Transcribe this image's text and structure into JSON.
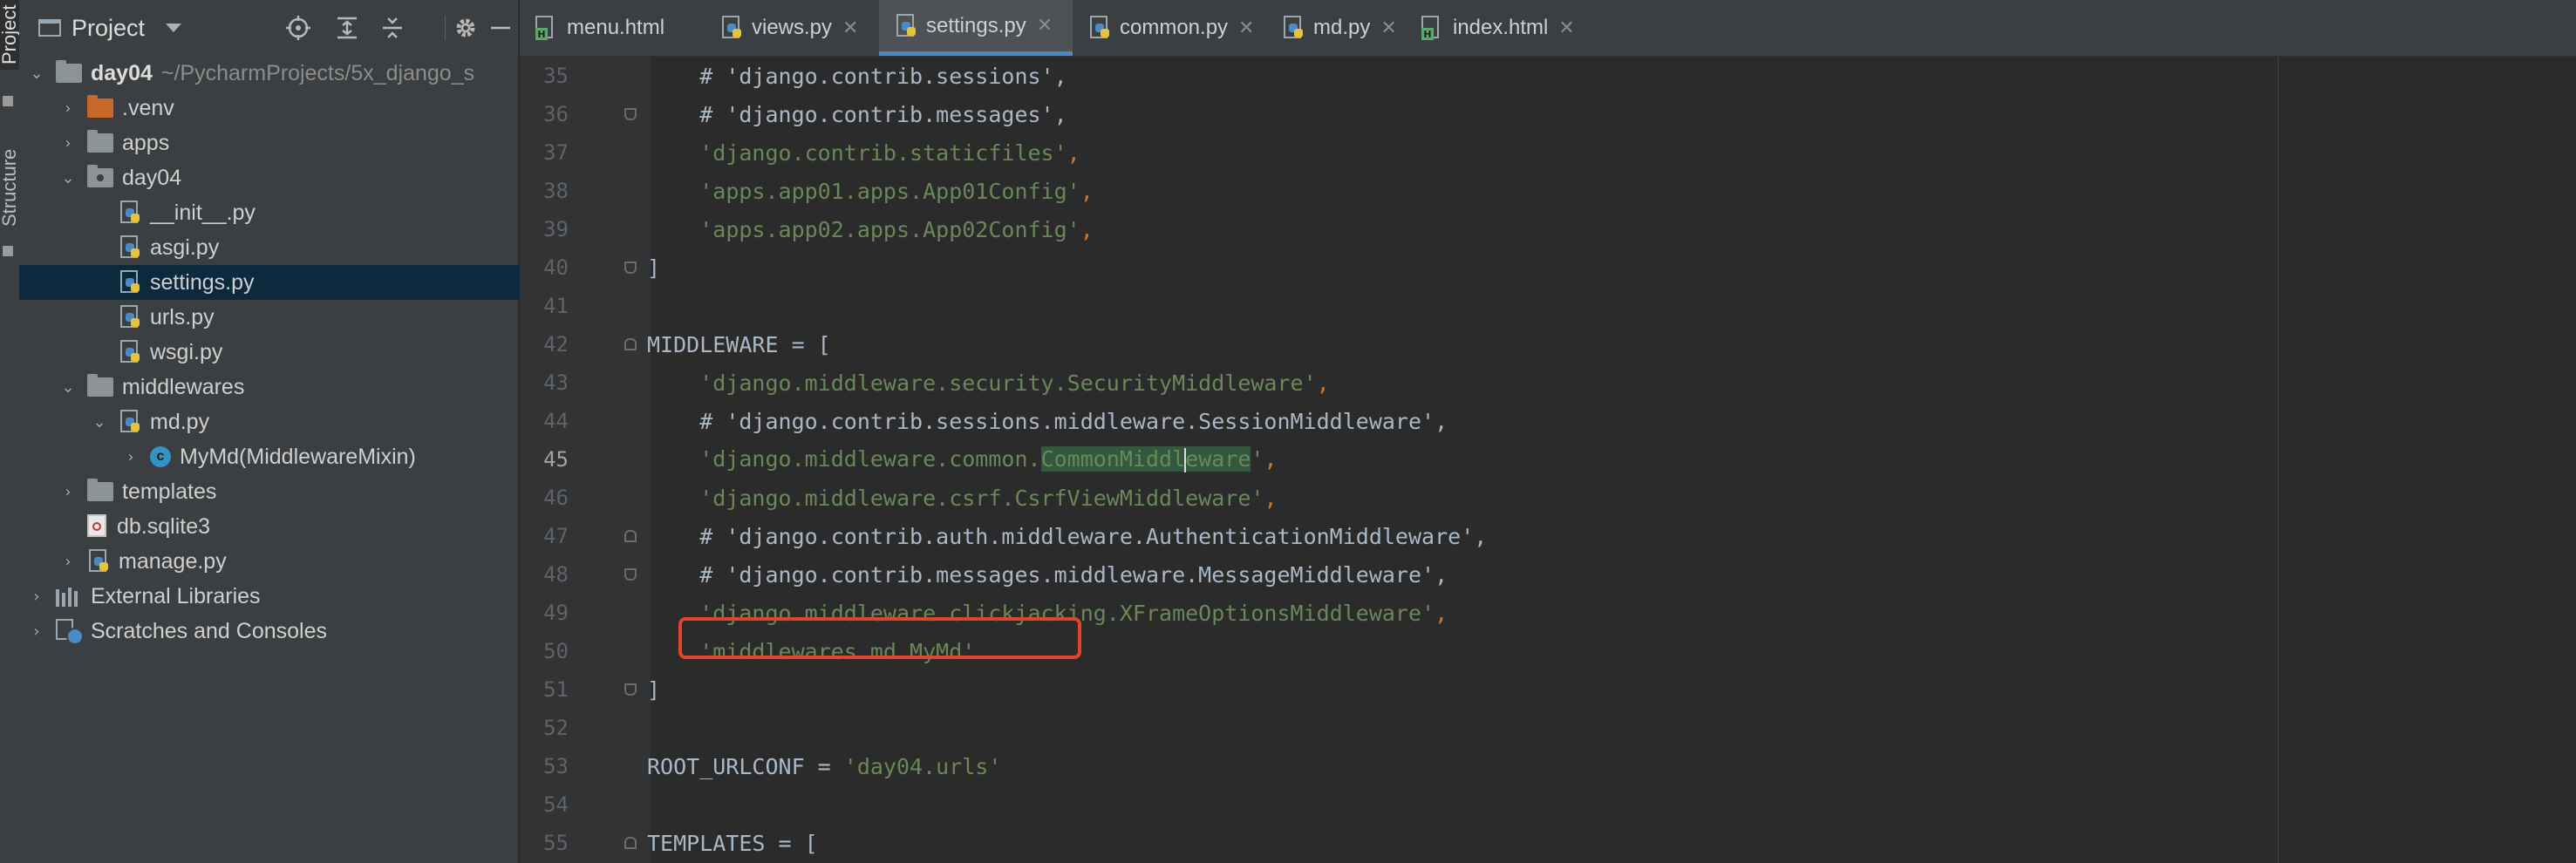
{
  "toolstrip": {
    "project_tab": "Project",
    "structure_tab": "Structure"
  },
  "project_panel": {
    "title": "Project",
    "header_icons": [
      "crosshair-icon",
      "expand-all-icon",
      "collapse-all-icon",
      "gear-icon",
      "minimize-icon"
    ],
    "tree": [
      {
        "label": "day04",
        "path": "~/PycharmProjects/5x_django_s",
        "type": "root-folder",
        "expanded": true,
        "depth": 0
      },
      {
        "label": ".venv",
        "type": "folder-excluded",
        "expanded": false,
        "depth": 1
      },
      {
        "label": "apps",
        "type": "folder",
        "expanded": false,
        "depth": 1
      },
      {
        "label": "day04",
        "type": "package",
        "expanded": true,
        "depth": 1
      },
      {
        "label": "__init__.py",
        "type": "python-file",
        "depth": 2
      },
      {
        "label": "asgi.py",
        "type": "python-file",
        "depth": 2
      },
      {
        "label": "settings.py",
        "type": "python-file",
        "depth": 2,
        "selected": true
      },
      {
        "label": "urls.py",
        "type": "python-file",
        "depth": 2
      },
      {
        "label": "wsgi.py",
        "type": "python-file",
        "depth": 2
      },
      {
        "label": "middlewares",
        "type": "folder",
        "expanded": true,
        "depth": 1
      },
      {
        "label": "md.py",
        "type": "python-file",
        "expanded": true,
        "depth": 2
      },
      {
        "label": "MyMd(MiddlewareMixin)",
        "type": "class",
        "expanded": false,
        "depth": 3
      },
      {
        "label": "templates",
        "type": "folder",
        "expanded": false,
        "depth": 1
      },
      {
        "label": "db.sqlite3",
        "type": "db-file",
        "depth": 1
      },
      {
        "label": "manage.py",
        "type": "python-file",
        "expanded": false,
        "depth": 1
      },
      {
        "label": "External Libraries",
        "type": "libraries",
        "expanded": false,
        "depth": 0
      },
      {
        "label": "Scratches and Consoles",
        "type": "scratches",
        "expanded": false,
        "depth": 0
      }
    ]
  },
  "tabs": [
    {
      "label": "menu.html",
      "icon": "html-file-icon",
      "active": false
    },
    {
      "label": "views.py",
      "icon": "python-file-icon",
      "active": false
    },
    {
      "label": "settings.py",
      "icon": "python-file-icon",
      "active": true
    },
    {
      "label": "common.py",
      "icon": "python-file-icon",
      "active": false
    },
    {
      "label": "md.py",
      "icon": "python-file-icon",
      "active": false
    },
    {
      "label": "index.html",
      "icon": "html-file-icon",
      "active": false
    }
  ],
  "editor": {
    "current_line": "45",
    "lines": [
      {
        "num": "35",
        "indent": "    ",
        "comment": "# 'django.contrib.sessions',"
      },
      {
        "num": "36",
        "indent": "    ",
        "comment": "# 'django.contrib.messages',"
      },
      {
        "num": "37",
        "indent": "    ",
        "str": "'django.contrib.staticfiles'",
        "op": ","
      },
      {
        "num": "38",
        "indent": "    ",
        "str": "'apps.app01.apps.App01Config'",
        "op": ","
      },
      {
        "num": "39",
        "indent": "    ",
        "str": "'apps.app02.apps.App02Config'",
        "op": ","
      },
      {
        "num": "40",
        "plain": "]"
      },
      {
        "num": "41",
        "plain": ""
      },
      {
        "num": "42",
        "plain": "MIDDLEWARE = ["
      },
      {
        "num": "43",
        "indent": "    ",
        "str": "'django.middleware.security.SecurityMiddleware'",
        "op": ","
      },
      {
        "num": "44",
        "indent": "    ",
        "comment": "# 'django.contrib.sessions.middleware.SessionMiddleware',"
      },
      {
        "num": "45",
        "indent": "    ",
        "str_a": "'django.middleware.common.",
        "str_hl": "CommonMiddl",
        "str_hl2": "eware",
        "str_b": "'",
        "op": ","
      },
      {
        "num": "46",
        "indent": "    ",
        "str": "'django.middleware.csrf.CsrfViewMiddleware'",
        "op": ","
      },
      {
        "num": "47",
        "indent": "    ",
        "comment": "# 'django.contrib.auth.middleware.AuthenticationMiddleware',"
      },
      {
        "num": "48",
        "indent": "    ",
        "comment": "# 'django.contrib.messages.middleware.MessageMiddleware',"
      },
      {
        "num": "49",
        "indent": "    ",
        "str": "'django.middleware.clickjacking.XFrameOptionsMiddleware'",
        "op": ","
      },
      {
        "num": "50",
        "indent": "    ",
        "str": "'middlewares.md.MyMd'"
      },
      {
        "num": "51",
        "plain": "]"
      },
      {
        "num": "52",
        "plain": ""
      },
      {
        "num": "53",
        "plain": "ROOT_URLCONF = ",
        "str": "'day04.urls'"
      },
      {
        "num": "54",
        "plain": ""
      },
      {
        "num": "55",
        "plain": "TEMPLATES = ["
      }
    ]
  },
  "colors": {
    "string": "#6a8759",
    "keyword_op": "#cc7832",
    "plain": "#a9b7c6",
    "selection": "#0d293e",
    "highlight_box": "#e0442a",
    "tab_underline": "#4a88c7"
  }
}
